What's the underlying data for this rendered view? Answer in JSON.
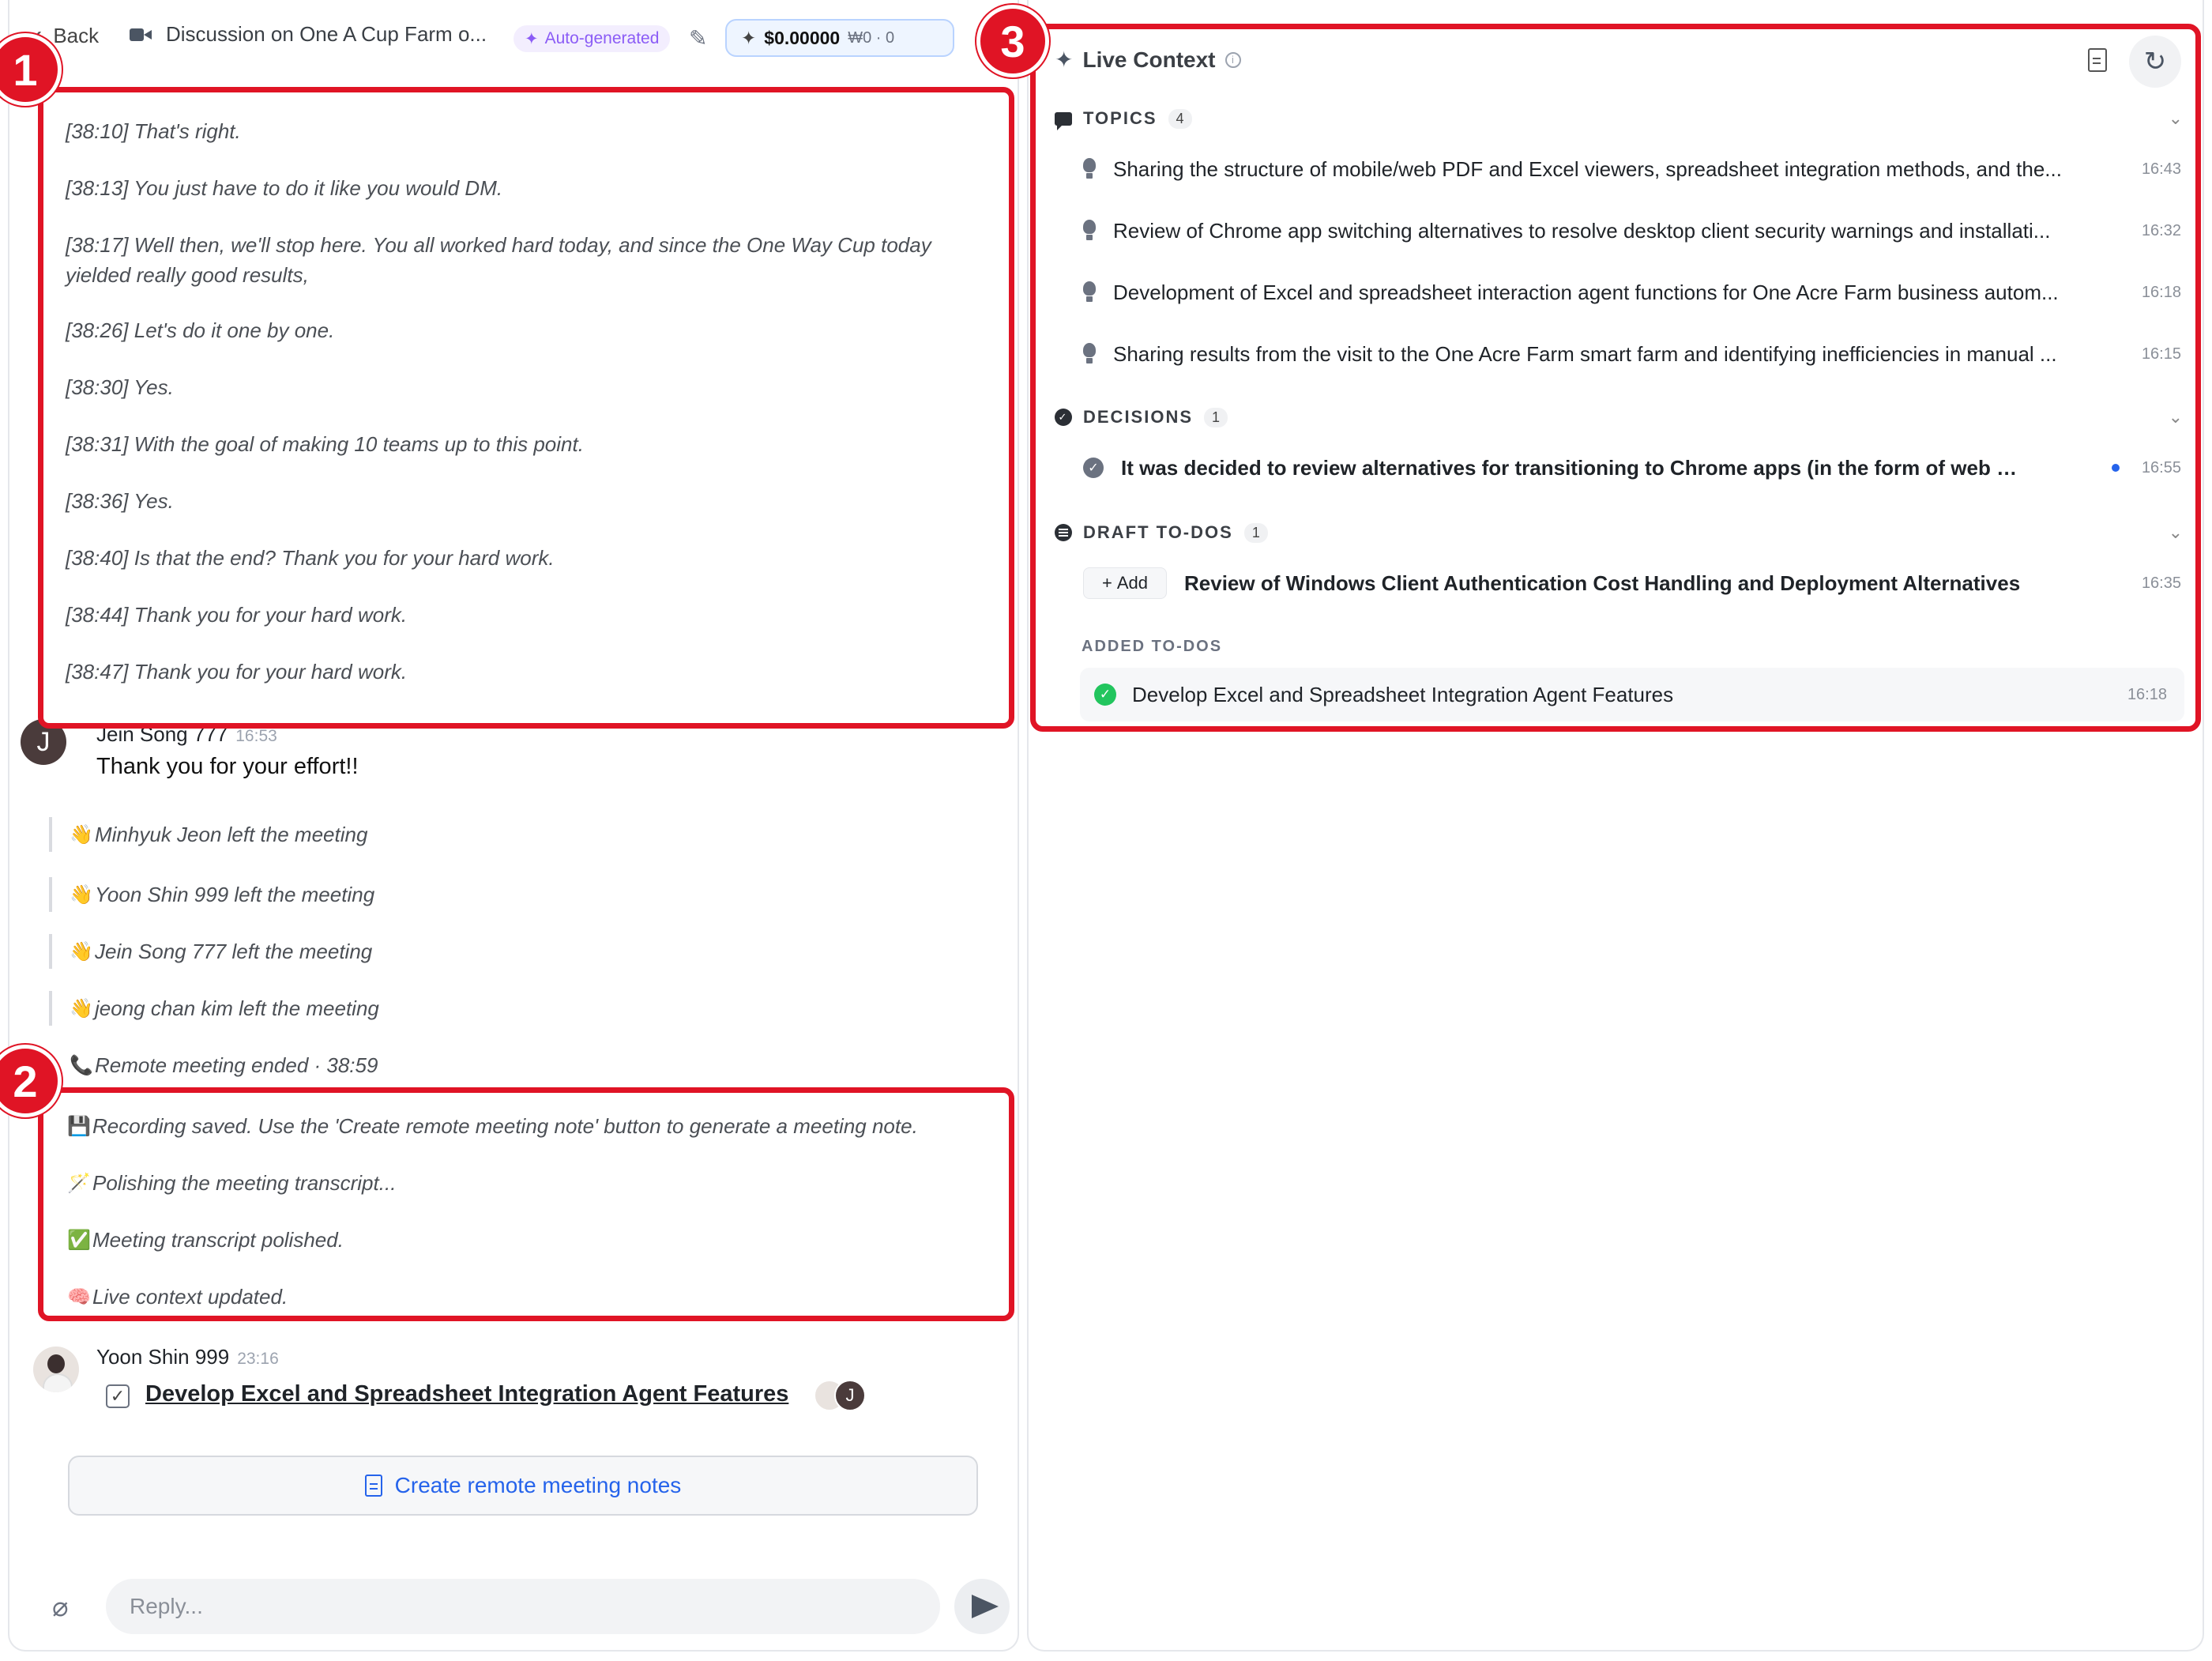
{
  "topbar": {
    "back_label": "Back",
    "title": "Discussion on One A Cup Farm o...",
    "badge": "Auto-generated",
    "cost_amount": "$0.00000",
    "cost_sub": "₩0 · 0"
  },
  "transcript": [
    "[38:10] That's right.",
    "[38:13] You just have to do it like you would DM.",
    "[38:17] Well then, we'll stop here. You all worked hard today, and since the One Way Cup today yielded really good results,",
    "[38:26] Let's do it one by one.",
    "[38:30] Yes.",
    "[38:31] With the goal of making 10 teams up to this point.",
    "[38:36] Yes.",
    "[38:40] Is that the end? Thank you for your hard work.",
    "[38:44] Thank you for your hard work.",
    "[38:47] Thank you for your hard work."
  ],
  "message1": {
    "author": "Jein Song 777",
    "time": "16:53",
    "avatar_letter": "J",
    "body": "Thank you for your effort!!"
  },
  "system_events": [
    {
      "emoji": "👋",
      "text": "Minhyuk Jeon left the meeting"
    },
    {
      "emoji": "👋",
      "text": "Yoon Shin 999 left the meeting"
    },
    {
      "emoji": "👋",
      "text": "Jein Song 777 left the meeting"
    },
    {
      "emoji": "👋",
      "text": "jeong chan kim left the meeting"
    },
    {
      "emoji": "📞",
      "text": "Remote meeting ended · 38:59"
    }
  ],
  "highlight_events": [
    {
      "emoji": "💾",
      "text": "Recording saved. Use the 'Create remote meeting note' button to generate a meeting note."
    },
    {
      "emoji": "🪄",
      "text": "Polishing the meeting transcript..."
    },
    {
      "emoji": "✅",
      "text": "Meeting transcript polished."
    },
    {
      "emoji": "🧠",
      "text": "Live context updated."
    }
  ],
  "message2": {
    "author": "Yoon Shin 999",
    "time": "23:16",
    "todo_link": "Develop Excel and Spreadsheet Integration Agent Features",
    "mini_avatar_letter": "J"
  },
  "create_notes_label": "Create remote meeting notes",
  "reply": {
    "placeholder": "Reply..."
  },
  "live_context": {
    "title": "Live Context",
    "topics": {
      "label": "TOPICS",
      "count": "4",
      "items": [
        {
          "text": "Sharing the structure of mobile/web PDF and Excel viewers, spreadsheet integration methods, and the...",
          "time": "16:43"
        },
        {
          "text": "Review of Chrome app switching alternatives to resolve desktop client security warnings and installati...",
          "time": "16:32"
        },
        {
          "text": "Development of Excel and spreadsheet interaction agent functions for One Acre Farm business autom...",
          "time": "16:18"
        },
        {
          "text": "Sharing results from the visit to the One Acre Farm smart farm and identifying inefficiencies in manual ...",
          "time": "16:15"
        }
      ]
    },
    "decisions": {
      "label": "DECISIONS",
      "count": "1",
      "items": [
        {
          "text": "It was decided to review alternatives for transitioning to Chrome apps (in the form of web page-b...",
          "time": "16:55"
        }
      ]
    },
    "draft_todos": {
      "label": "DRAFT TO-DOS",
      "count": "1",
      "add_label": "Add",
      "items": [
        {
          "text": "Review of Windows Client Authentication Cost Handling and Deployment Alternatives",
          "time": "16:35"
        }
      ]
    },
    "added_todos": {
      "label": "ADDED TO-DOS",
      "items": [
        {
          "text": "Develop Excel and Spreadsheet Integration Agent Features",
          "time": "16:18"
        }
      ]
    }
  },
  "annotations": [
    "1",
    "2",
    "3"
  ],
  "colors": {
    "highlight_red": "#e01425",
    "link_blue": "#2563eb",
    "success_green": "#22c55e",
    "badge_purple": "#8b5cf6"
  }
}
